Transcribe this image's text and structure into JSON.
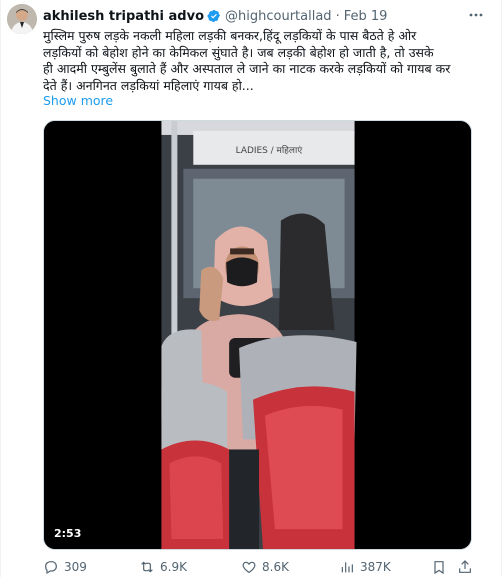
{
  "author": {
    "display_name": "akhilesh tripathi advo",
    "handle": "@highcourtallad",
    "separator": "·",
    "date": "Feb 19"
  },
  "tweet": {
    "text": "मुस्लिम पुरुष लड़के नकली महिला लड़की बनकर,हिंदू लड़कियों के पास बैठते हे ओर\nलड़कियों को बेहोश होने का केमिकल सुंघाते है। जब लड़की बेहोश हो जाती है, तो उसके\nही आदमी एम्बुलेंस बुलाते हैं और अस्पताल ले जाने का नाटक करके लड़कियों को गायब कर\nदेते हैं। अनगिनत लड़कियां महिलाएं गायब हो...",
    "show_more": "Show more"
  },
  "media": {
    "duration": "2:53",
    "bus_sign": "LADIES / महिलाएं"
  },
  "actions": {
    "replies": "309",
    "reposts": "6.9K",
    "likes": "8.6K",
    "views": "387K"
  },
  "colors": {
    "link": "#1d9bf0",
    "verified": "#1d9bf0",
    "muted": "#536471",
    "seat_red": "#c8323a",
    "seat_grey": "#b9bcc1"
  },
  "icons": [
    "verified-icon",
    "more-icon",
    "reply-icon",
    "retweet-icon",
    "like-icon",
    "views-icon",
    "bookmark-icon",
    "share-icon"
  ]
}
